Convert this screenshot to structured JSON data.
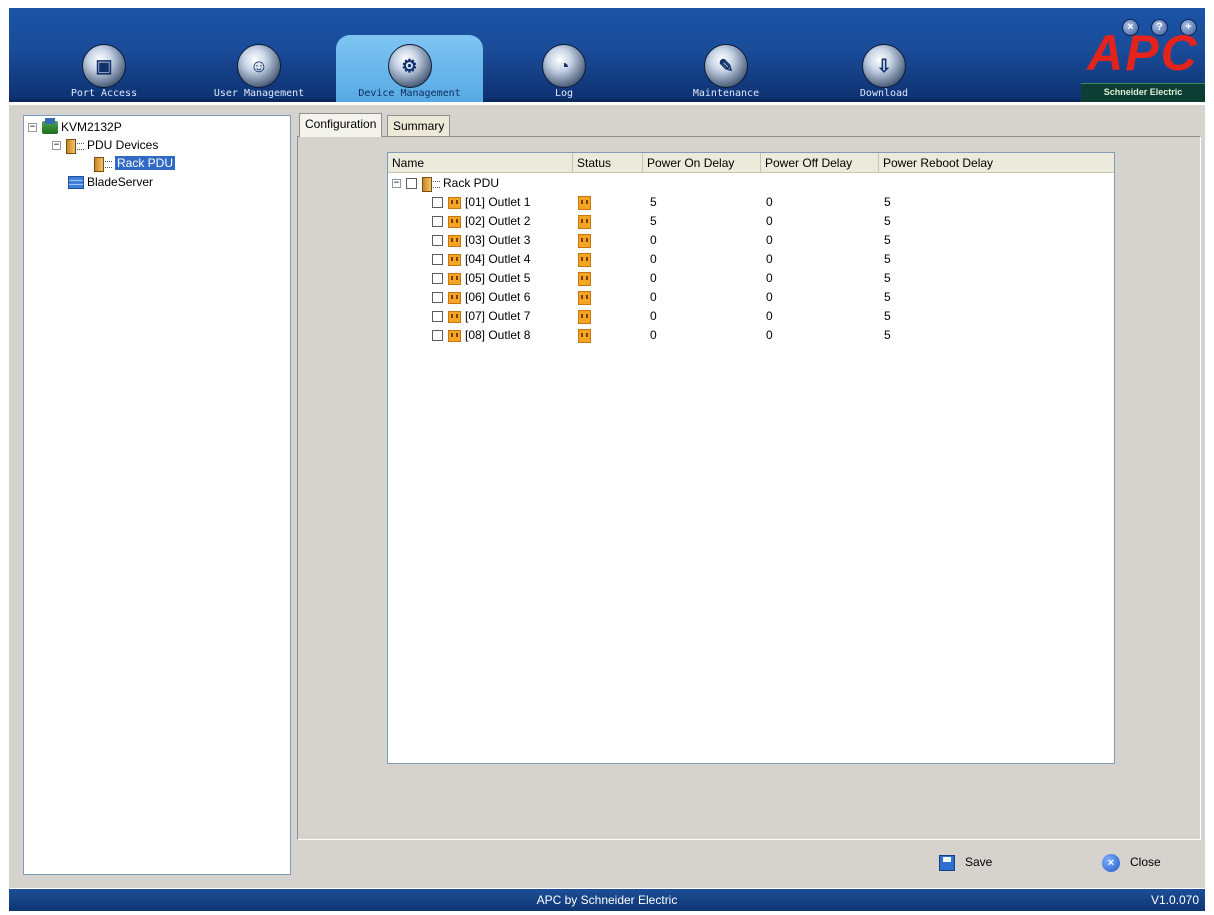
{
  "nav_tabs": [
    {
      "label": "Port Access",
      "icon": "port-access-icon",
      "glyph": "▣"
    },
    {
      "label": "User Management",
      "icon": "user-management-icon",
      "glyph": "☺"
    },
    {
      "label": "Device Management",
      "icon": "device-management-icon",
      "glyph": "⚙"
    },
    {
      "label": "Log",
      "icon": "log-icon",
      "glyph": "◔"
    },
    {
      "label": "Maintenance",
      "icon": "maintenance-icon",
      "glyph": "✎"
    },
    {
      "label": "Download",
      "icon": "download-icon",
      "glyph": "⇩"
    }
  ],
  "active_tab": "Device Management",
  "top_controls": [
    {
      "icon": "logout-icon",
      "glyph": "×"
    },
    {
      "icon": "help-icon",
      "glyph": "?"
    },
    {
      "icon": "about-icon",
      "glyph": "+"
    }
  ],
  "logo": {
    "text": "APC",
    "subtitle": "Schneider Electric",
    "color": "#e4231c"
  },
  "tree": {
    "root": "KVM2132P",
    "group": "PDU Devices",
    "selected": "Rack PDU",
    "blade": "BladeServer"
  },
  "tabs": {
    "configuration": "Configuration",
    "summary": "Summary"
  },
  "table": {
    "columns": [
      "Name",
      "Status",
      "Power On Delay",
      "Power Off Delay",
      "Power Reboot Delay"
    ],
    "group": "Rack PDU",
    "rows": [
      {
        "name": "[01] Outlet 1",
        "on": "5",
        "off": "0",
        "reboot": "5"
      },
      {
        "name": "[02] Outlet 2",
        "on": "5",
        "off": "0",
        "reboot": "5"
      },
      {
        "name": "[03] Outlet 3",
        "on": "0",
        "off": "0",
        "reboot": "5"
      },
      {
        "name": "[04] Outlet 4",
        "on": "0",
        "off": "0",
        "reboot": "5"
      },
      {
        "name": "[05] Outlet 5",
        "on": "0",
        "off": "0",
        "reboot": "5"
      },
      {
        "name": "[06] Outlet 6",
        "on": "0",
        "off": "0",
        "reboot": "5"
      },
      {
        "name": "[07] Outlet 7",
        "on": "0",
        "off": "0",
        "reboot": "5"
      },
      {
        "name": "[08] Outlet 8",
        "on": "0",
        "off": "0",
        "reboot": "5"
      }
    ]
  },
  "buttons": {
    "save": "Save",
    "close": "Close"
  },
  "status_bar": {
    "text": "APC by Schneider Electric",
    "version": "V1.0.070"
  },
  "colors": {
    "header": "#1a4c99",
    "active_tab": "#7fc5f3",
    "selection": "#316ac5",
    "panel": "#d6d3ce"
  }
}
